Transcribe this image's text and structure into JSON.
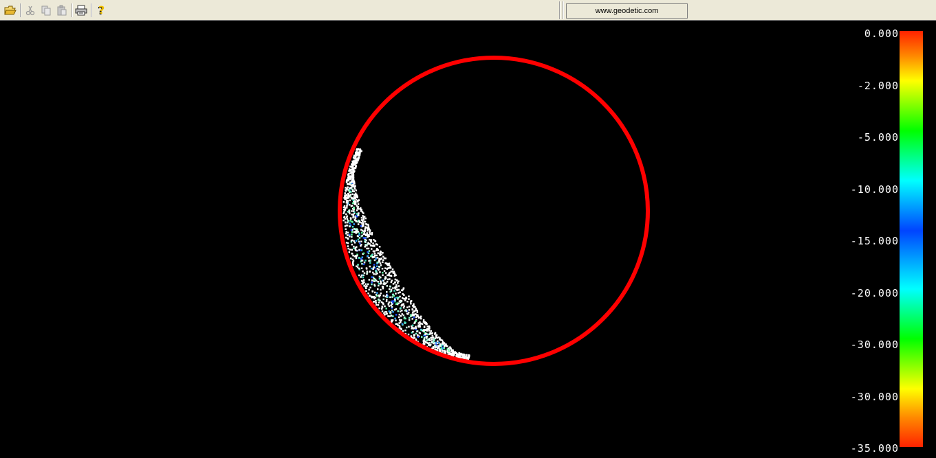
{
  "toolbar": {
    "url_label": "www.geodetic.com",
    "buttons": [
      {
        "name": "open-button",
        "icon": "folder-open-icon"
      },
      {
        "name": "cut-button",
        "icon": "scissors-icon"
      },
      {
        "name": "copy-button",
        "icon": "copy-icon"
      },
      {
        "name": "paste-button",
        "icon": "clipboard-icon"
      },
      {
        "name": "print-button",
        "icon": "printer-icon"
      },
      {
        "name": "help-button",
        "icon": "question-mark-icon"
      }
    ]
  },
  "legend": {
    "labels": [
      "0.000",
      "-2.000",
      "-5.000",
      "-10.000",
      "-15.000",
      "-20.000",
      "-30.000",
      "-30.000",
      "-35.000"
    ]
  },
  "plot": {
    "ring_color": "#ff0000",
    "point_color": "#ffffff"
  }
}
